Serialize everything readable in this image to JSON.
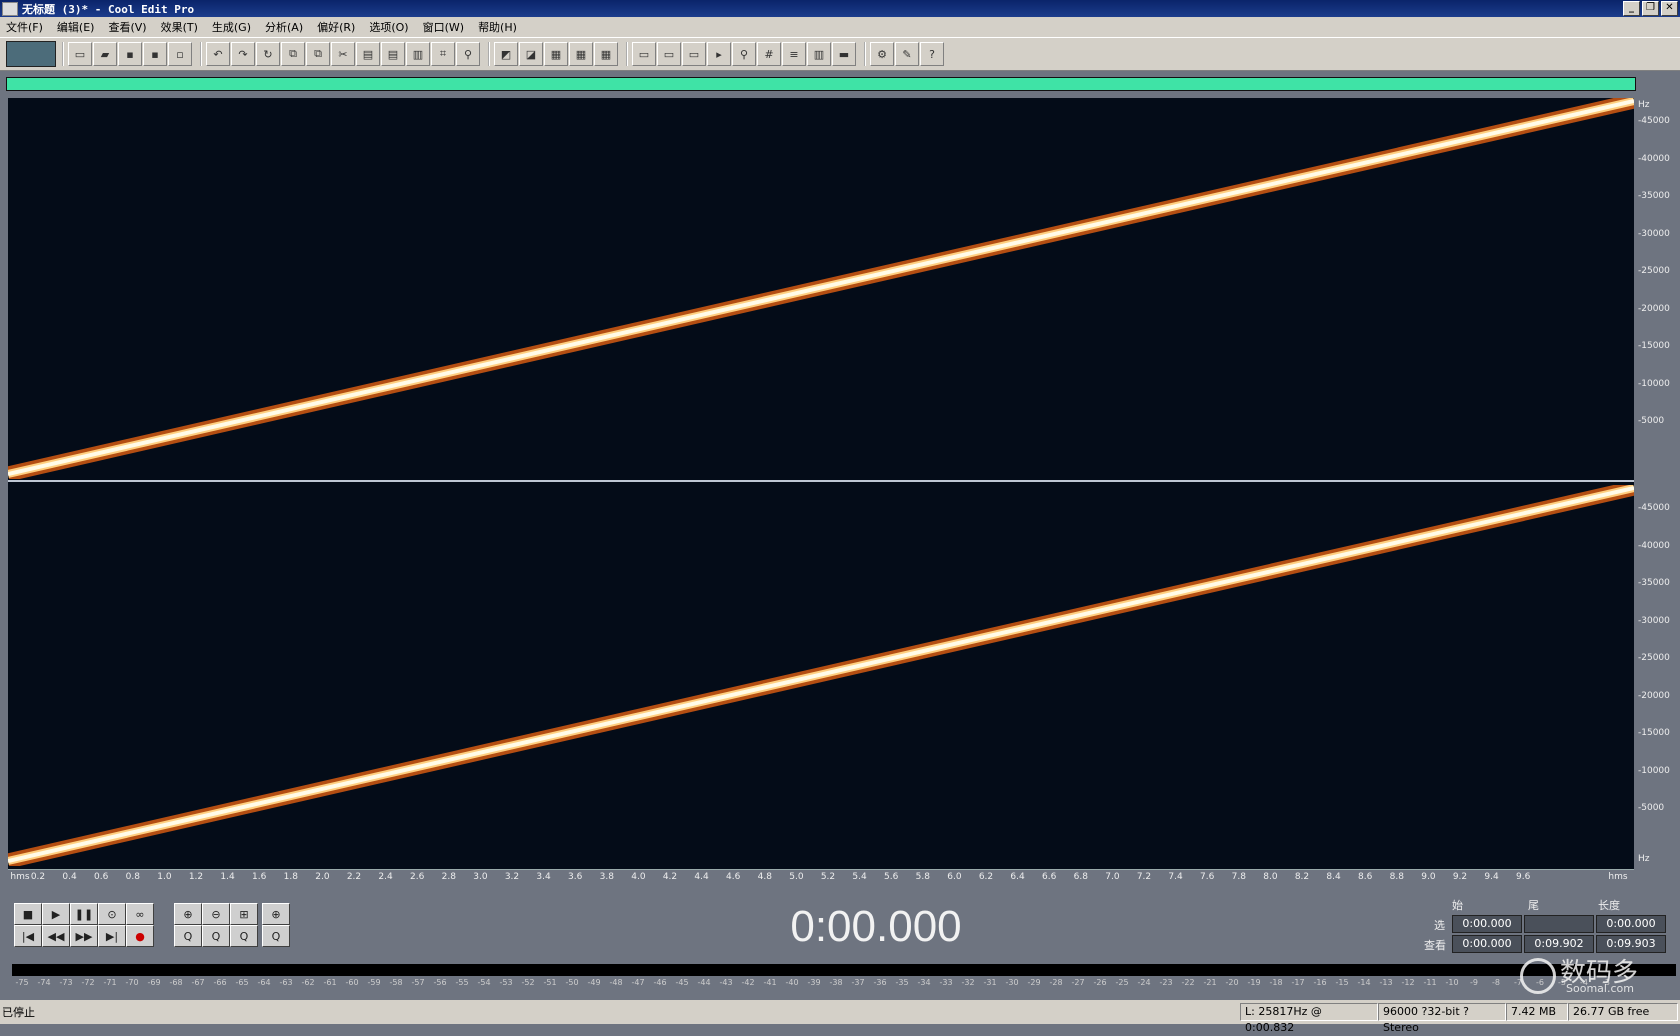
{
  "window": {
    "title": "无标题 (3)* - Cool Edit Pro",
    "controls": [
      "_",
      "❐",
      "✕"
    ]
  },
  "menu": [
    "文件(F)",
    "编辑(E)",
    "查看(V)",
    "效果(T)",
    "生成(G)",
    "分析(A)",
    "偏好(R)",
    "选项(O)",
    "窗口(W)",
    "帮助(H)"
  ],
  "toolbar": {
    "groups": [
      [
        "new-file-icon",
        "open-file-icon",
        "save-icon",
        "save-all-icon",
        "close-icon"
      ],
      [
        "undo-icon",
        "redo-icon",
        "repeat-icon",
        "copy-icon",
        "copy-new-icon",
        "cut-icon",
        "paste-icon",
        "paste-new-icon",
        "mix-paste-icon",
        "crop-icon",
        "snap-icon"
      ],
      [
        "envelope-icon",
        "normalize-icon",
        "spectral-view-icon",
        "waveform-view-icon",
        "spectral-pan-icon"
      ],
      [
        "zoom-full-icon",
        "zoom-sel-icon",
        "cue-list-icon",
        "play-list-icon",
        "info-icon",
        "time-format-icon",
        "frequency-icon",
        "mixer-icon",
        "metronome-icon"
      ],
      [
        "settings-icon",
        "tool-icon",
        "help-icon"
      ]
    ]
  },
  "colors": {
    "overview": "#3fe3a6",
    "spectrogram_bg": "#040c18",
    "sweep_core": "#fffbe8",
    "sweep_glow": "#ff7a1a"
  },
  "vscale": {
    "unit": "Hz",
    "labels": [
      "45000",
      "40000",
      "35000",
      "30000",
      "25000",
      "20000",
      "15000",
      "10000",
      "5000"
    ]
  },
  "hscale": {
    "start": "hms",
    "end": "hms",
    "ticks": [
      "0.2",
      "0.4",
      "0.6",
      "0.8",
      "1.0",
      "1.2",
      "1.4",
      "1.6",
      "1.8",
      "2.0",
      "2.2",
      "2.4",
      "2.6",
      "2.8",
      "3.0",
      "3.2",
      "3.4",
      "3.6",
      "3.8",
      "4.0",
      "4.2",
      "4.4",
      "4.6",
      "4.8",
      "5.0",
      "5.2",
      "5.4",
      "5.6",
      "5.8",
      "6.0",
      "6.2",
      "6.4",
      "6.6",
      "6.8",
      "7.0",
      "7.2",
      "7.4",
      "7.6",
      "7.8",
      "8.0",
      "8.2",
      "8.4",
      "8.6",
      "8.8",
      "9.0",
      "9.2",
      "9.4",
      "9.6"
    ]
  },
  "transport": {
    "time": "0:00.000",
    "row1": [
      "■",
      "▶",
      "❚❚",
      "⊙",
      "∞"
    ],
    "row2": [
      "|◀",
      "◀◀",
      "▶▶",
      "▶|",
      "●"
    ],
    "zoom_row1": [
      "⊕",
      "⊖",
      "⊞",
      "⊕"
    ],
    "zoom_row2": [
      "Q",
      "Q",
      "Q",
      "Q"
    ]
  },
  "selection": {
    "headers": [
      "始",
      "尾",
      "长度"
    ],
    "rows": [
      {
        "label": "选",
        "start": "0:00.000",
        "end": "",
        "length": "0:00.000"
      },
      {
        "label": "查看",
        "start": "0:00.000",
        "end": "0:09.902",
        "length": "0:09.903"
      }
    ]
  },
  "level_ticks": [
    "-75",
    "-74",
    "-73",
    "-72",
    "-71",
    "-70",
    "-69",
    "-68",
    "-67",
    "-66",
    "-65",
    "-64",
    "-63",
    "-62",
    "-61",
    "-60",
    "-59",
    "-58",
    "-57",
    "-56",
    "-55",
    "-54",
    "-53",
    "-52",
    "-51",
    "-50",
    "-49",
    "-48",
    "-47",
    "-46",
    "-45",
    "-44",
    "-43",
    "-42",
    "-41",
    "-40",
    "-39",
    "-38",
    "-37",
    "-36",
    "-35",
    "-34",
    "-33",
    "-32",
    "-31",
    "-30",
    "-29",
    "-28",
    "-27",
    "-26",
    "-25",
    "-24",
    "-23",
    "-22",
    "-21",
    "-20",
    "-19",
    "-18",
    "-17",
    "-16",
    "-15",
    "-14",
    "-13",
    "-12",
    "-11",
    "-10",
    "-9",
    "-8",
    "-7",
    "-6",
    "-5",
    "-4",
    "-3"
  ],
  "status": {
    "state": "已停止",
    "cursor": "L: 25817Hz @   0:00.832",
    "format": "96000 ?32-bit ?Stereo",
    "size": "7.42 MB",
    "free": "26.77 GB free"
  },
  "watermark": {
    "text": "数码多",
    "url": "Soomal.com"
  }
}
